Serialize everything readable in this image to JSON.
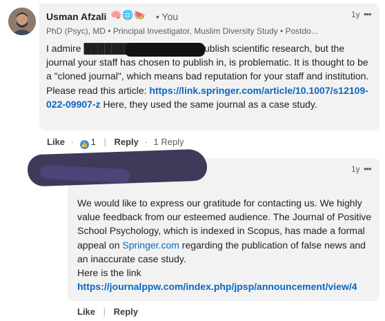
{
  "comment": {
    "author": "Usman Afzali",
    "emojis": "🧠🌐🍉",
    "you_label": "• You",
    "headline": "PhD (Psyc), MD • Principal Investigator, Muslim Diversity Study • Postdo...",
    "time": "1y",
    "more": "•••",
    "text_before_link": "I admire ███████'s staff trying to publish scientific research, but the journal your staff has chosen to publish in, is problematic. It is thought to be a \"cloned journal\", which means bad reputation for your staff and institution. Please read this article: ",
    "link": "https://link.springer.com/article/10.1007/s12109-022-09907-z",
    "text_after_link": " Here, they used the same journal as a case study.",
    "actions": {
      "like": "Like",
      "dot": "·",
      "reaction_count": "1",
      "reply": "Reply",
      "replies": "1 Reply"
    }
  },
  "reply": {
    "time": "1y",
    "more": "•••",
    "line1": "We would like to express our gratitude for contacting us. We highly value feedback from our esteemed audience. The Journal of Positive School Psychology, which is indexed in Scopus, has made a formal appeal on ",
    "springer_link": "Springer.com",
    "line2": " regarding the publication of false news and an inaccurate case study.",
    "line3": "Here is the link",
    "link": "https://journalppw.com/index.php/jpsp/announcement/view/4",
    "actions": {
      "like": "Like",
      "reply": "Reply"
    }
  },
  "colors": {
    "link": "#0a66c2",
    "bubble": "#f2f2f2",
    "redaction": "#3e3a5a"
  }
}
